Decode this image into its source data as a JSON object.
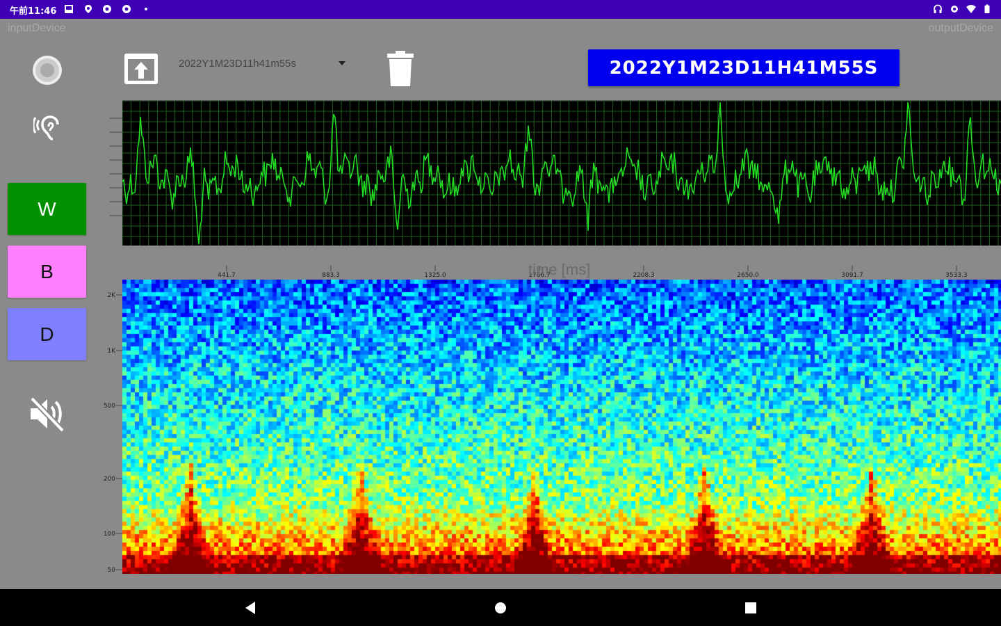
{
  "status_bar": {
    "time": "午前11:46",
    "left_icons": [
      "image-icon",
      "location-icon",
      "record-icon",
      "record-icon",
      "dot-icon"
    ],
    "right_icons": [
      "headset-icon",
      "vpn-key-icon",
      "wifi-icon",
      "battery-icon"
    ]
  },
  "devices": {
    "input_label": "inputDevice",
    "output_label": "outputDevice"
  },
  "sidebar": {
    "record_icon": "record-icon",
    "hearing_icon": "hearing-icon",
    "buttons": [
      {
        "label": "W",
        "color": "#009000",
        "text_color": "#ffffff"
      },
      {
        "label": "B",
        "color": "#ff80ff",
        "text_color": "#111111"
      },
      {
        "label": "D",
        "color": "#8080ff",
        "text_color": "#111111"
      }
    ],
    "mute_icon": "volume-off-icon"
  },
  "toolbar": {
    "file_select_value": "2022Y1M23D11h41m55s",
    "title_button": "2022Y1M23D11H41M55S",
    "upload_icon": "upload-icon",
    "delete_icon": "trash-icon"
  },
  "waveform": {
    "xlabel": "time [ms]",
    "x_ticks": [
      "441.7",
      "883.3",
      "1325.0",
      "1766.7",
      "2208.3",
      "2650.0",
      "3091.7",
      "3533.3"
    ],
    "line_color": "#22dd22",
    "grid_color": "#1f5f1f"
  },
  "spectrogram": {
    "y_ticks": [
      "2K",
      "1K",
      "500",
      "200",
      "100",
      "50"
    ],
    "colormap": "jet"
  },
  "nav_bar": {
    "icons": [
      "back-icon",
      "home-icon",
      "recents-icon"
    ]
  }
}
